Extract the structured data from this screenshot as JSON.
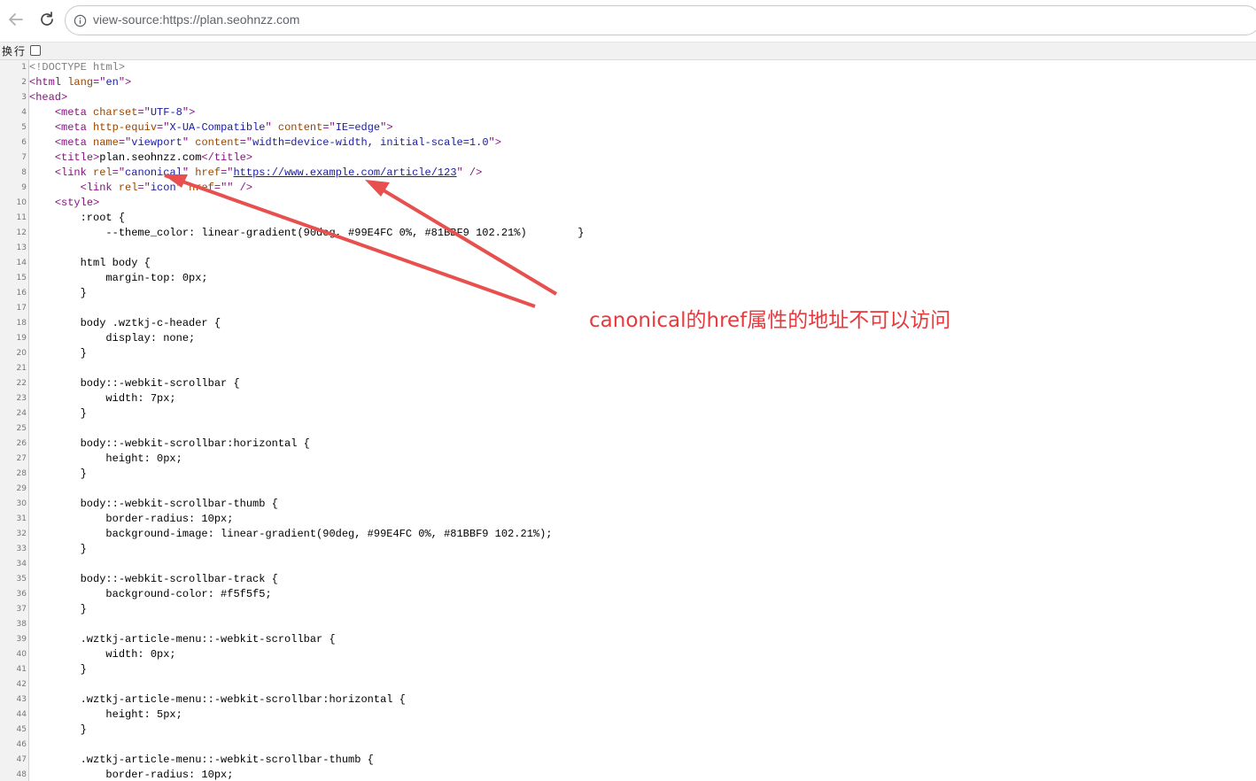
{
  "browser": {
    "url": "view-source:https://plan.seohnzz.com",
    "nav_icons": [
      "back-arrow-icon",
      "reload-icon",
      "info-icon"
    ]
  },
  "wrap_toggle": {
    "label": "换行",
    "checked": false
  },
  "source_lines": [
    {
      "n": "1",
      "tokens": [
        {
          "t": "com",
          "v": "<!DOCTYPE html>"
        }
      ]
    },
    {
      "n": "2",
      "tokens": [
        {
          "t": "tag",
          "v": "<html "
        },
        {
          "t": "attr",
          "v": "lang"
        },
        {
          "t": "tag",
          "v": "=\""
        },
        {
          "t": "val",
          "v": "en"
        },
        {
          "t": "tag",
          "v": "\">"
        }
      ]
    },
    {
      "n": "3",
      "tokens": [
        {
          "t": "tag",
          "v": "<head>"
        }
      ]
    },
    {
      "n": "4",
      "tokens": [
        {
          "t": "txt",
          "v": "    "
        },
        {
          "t": "tag",
          "v": "<meta "
        },
        {
          "t": "attr",
          "v": "charset"
        },
        {
          "t": "tag",
          "v": "=\""
        },
        {
          "t": "val",
          "v": "UTF-8"
        },
        {
          "t": "tag",
          "v": "\">"
        }
      ]
    },
    {
      "n": "5",
      "tokens": [
        {
          "t": "txt",
          "v": "    "
        },
        {
          "t": "tag",
          "v": "<meta "
        },
        {
          "t": "attr",
          "v": "http-equiv"
        },
        {
          "t": "tag",
          "v": "=\""
        },
        {
          "t": "val",
          "v": "X-UA-Compatible"
        },
        {
          "t": "tag",
          "v": "\" "
        },
        {
          "t": "attr",
          "v": "content"
        },
        {
          "t": "tag",
          "v": "=\""
        },
        {
          "t": "val",
          "v": "IE=edge"
        },
        {
          "t": "tag",
          "v": "\">"
        }
      ]
    },
    {
      "n": "6",
      "tokens": [
        {
          "t": "txt",
          "v": "    "
        },
        {
          "t": "tag",
          "v": "<meta "
        },
        {
          "t": "attr",
          "v": "name"
        },
        {
          "t": "tag",
          "v": "=\""
        },
        {
          "t": "val",
          "v": "viewport"
        },
        {
          "t": "tag",
          "v": "\" "
        },
        {
          "t": "attr",
          "v": "content"
        },
        {
          "t": "tag",
          "v": "=\""
        },
        {
          "t": "val",
          "v": "width=device-width, initial-scale=1.0"
        },
        {
          "t": "tag",
          "v": "\">"
        }
      ]
    },
    {
      "n": "7",
      "tokens": [
        {
          "t": "txt",
          "v": "    "
        },
        {
          "t": "tag",
          "v": "<title>"
        },
        {
          "t": "txt",
          "v": "plan.seohnzz.com"
        },
        {
          "t": "tag",
          "v": "</title>"
        }
      ]
    },
    {
      "n": "8",
      "tokens": [
        {
          "t": "txt",
          "v": "    "
        },
        {
          "t": "tag",
          "v": "<link "
        },
        {
          "t": "attr",
          "v": "rel"
        },
        {
          "t": "tag",
          "v": "=\""
        },
        {
          "t": "val",
          "v": "canonical"
        },
        {
          "t": "tag",
          "v": "\" "
        },
        {
          "t": "attr",
          "v": "href"
        },
        {
          "t": "tag",
          "v": "=\""
        },
        {
          "t": "link",
          "v": "https://www.example.com/article/123"
        },
        {
          "t": "tag",
          "v": "\" />"
        }
      ]
    },
    {
      "n": "9",
      "tokens": [
        {
          "t": "txt",
          "v": "        "
        },
        {
          "t": "tag",
          "v": "<link "
        },
        {
          "t": "attr",
          "v": "rel"
        },
        {
          "t": "tag",
          "v": "=\""
        },
        {
          "t": "val",
          "v": "icon"
        },
        {
          "t": "tag",
          "v": "\" "
        },
        {
          "t": "attr",
          "v": "href"
        },
        {
          "t": "tag",
          "v": "=\"\" />"
        }
      ]
    },
    {
      "n": "10",
      "tokens": [
        {
          "t": "txt",
          "v": "    "
        },
        {
          "t": "tag",
          "v": "<style>"
        }
      ]
    },
    {
      "n": "11",
      "tokens": [
        {
          "t": "txt",
          "v": "        :root {"
        }
      ]
    },
    {
      "n": "12",
      "tokens": [
        {
          "t": "txt",
          "v": "            --theme_color: linear-gradient(90deg, #99E4FC 0%, #81BBF9 102.21%)        }"
        }
      ]
    },
    {
      "n": "13",
      "tokens": []
    },
    {
      "n": "14",
      "tokens": [
        {
          "t": "txt",
          "v": "        html body {"
        }
      ]
    },
    {
      "n": "15",
      "tokens": [
        {
          "t": "txt",
          "v": "            margin-top: 0px;"
        }
      ]
    },
    {
      "n": "16",
      "tokens": [
        {
          "t": "txt",
          "v": "        }"
        }
      ]
    },
    {
      "n": "17",
      "tokens": []
    },
    {
      "n": "18",
      "tokens": [
        {
          "t": "txt",
          "v": "        body .wztkj-c-header {"
        }
      ]
    },
    {
      "n": "19",
      "tokens": [
        {
          "t": "txt",
          "v": "            display: none;"
        }
      ]
    },
    {
      "n": "20",
      "tokens": [
        {
          "t": "txt",
          "v": "        }"
        }
      ]
    },
    {
      "n": "21",
      "tokens": []
    },
    {
      "n": "22",
      "tokens": [
        {
          "t": "txt",
          "v": "        body::-webkit-scrollbar {"
        }
      ]
    },
    {
      "n": "23",
      "tokens": [
        {
          "t": "txt",
          "v": "            width: 7px;"
        }
      ]
    },
    {
      "n": "24",
      "tokens": [
        {
          "t": "txt",
          "v": "        }"
        }
      ]
    },
    {
      "n": "25",
      "tokens": []
    },
    {
      "n": "26",
      "tokens": [
        {
          "t": "txt",
          "v": "        body::-webkit-scrollbar:horizontal {"
        }
      ]
    },
    {
      "n": "27",
      "tokens": [
        {
          "t": "txt",
          "v": "            height: 0px;"
        }
      ]
    },
    {
      "n": "28",
      "tokens": [
        {
          "t": "txt",
          "v": "        }"
        }
      ]
    },
    {
      "n": "29",
      "tokens": []
    },
    {
      "n": "30",
      "tokens": [
        {
          "t": "txt",
          "v": "        body::-webkit-scrollbar-thumb {"
        }
      ]
    },
    {
      "n": "31",
      "tokens": [
        {
          "t": "txt",
          "v": "            border-radius: 10px;"
        }
      ]
    },
    {
      "n": "32",
      "tokens": [
        {
          "t": "txt",
          "v": "            background-image: linear-gradient(90deg, #99E4FC 0%, #81BBF9 102.21%);"
        }
      ]
    },
    {
      "n": "33",
      "tokens": [
        {
          "t": "txt",
          "v": "        }"
        }
      ]
    },
    {
      "n": "34",
      "tokens": []
    },
    {
      "n": "35",
      "tokens": [
        {
          "t": "txt",
          "v": "        body::-webkit-scrollbar-track {"
        }
      ]
    },
    {
      "n": "36",
      "tokens": [
        {
          "t": "txt",
          "v": "            background-color: #f5f5f5;"
        }
      ]
    },
    {
      "n": "37",
      "tokens": [
        {
          "t": "txt",
          "v": "        }"
        }
      ]
    },
    {
      "n": "38",
      "tokens": []
    },
    {
      "n": "39",
      "tokens": [
        {
          "t": "txt",
          "v": "        .wztkj-article-menu::-webkit-scrollbar {"
        }
      ]
    },
    {
      "n": "40",
      "tokens": [
        {
          "t": "txt",
          "v": "            width: 0px;"
        }
      ]
    },
    {
      "n": "41",
      "tokens": [
        {
          "t": "txt",
          "v": "        }"
        }
      ]
    },
    {
      "n": "42",
      "tokens": []
    },
    {
      "n": "43",
      "tokens": [
        {
          "t": "txt",
          "v": "        .wztkj-article-menu::-webkit-scrollbar:horizontal {"
        }
      ]
    },
    {
      "n": "44",
      "tokens": [
        {
          "t": "txt",
          "v": "            height: 5px;"
        }
      ]
    },
    {
      "n": "45",
      "tokens": [
        {
          "t": "txt",
          "v": "        }"
        }
      ]
    },
    {
      "n": "46",
      "tokens": []
    },
    {
      "n": "47",
      "tokens": [
        {
          "t": "txt",
          "v": "        .wztkj-article-menu::-webkit-scrollbar-thumb {"
        }
      ]
    },
    {
      "n": "48",
      "tokens": [
        {
          "t": "txt",
          "v": "            border-radius: 10px;"
        }
      ]
    }
  ],
  "annotation": {
    "text": "canonical的href属性的地址不可以访问",
    "color": "#e8393c"
  }
}
